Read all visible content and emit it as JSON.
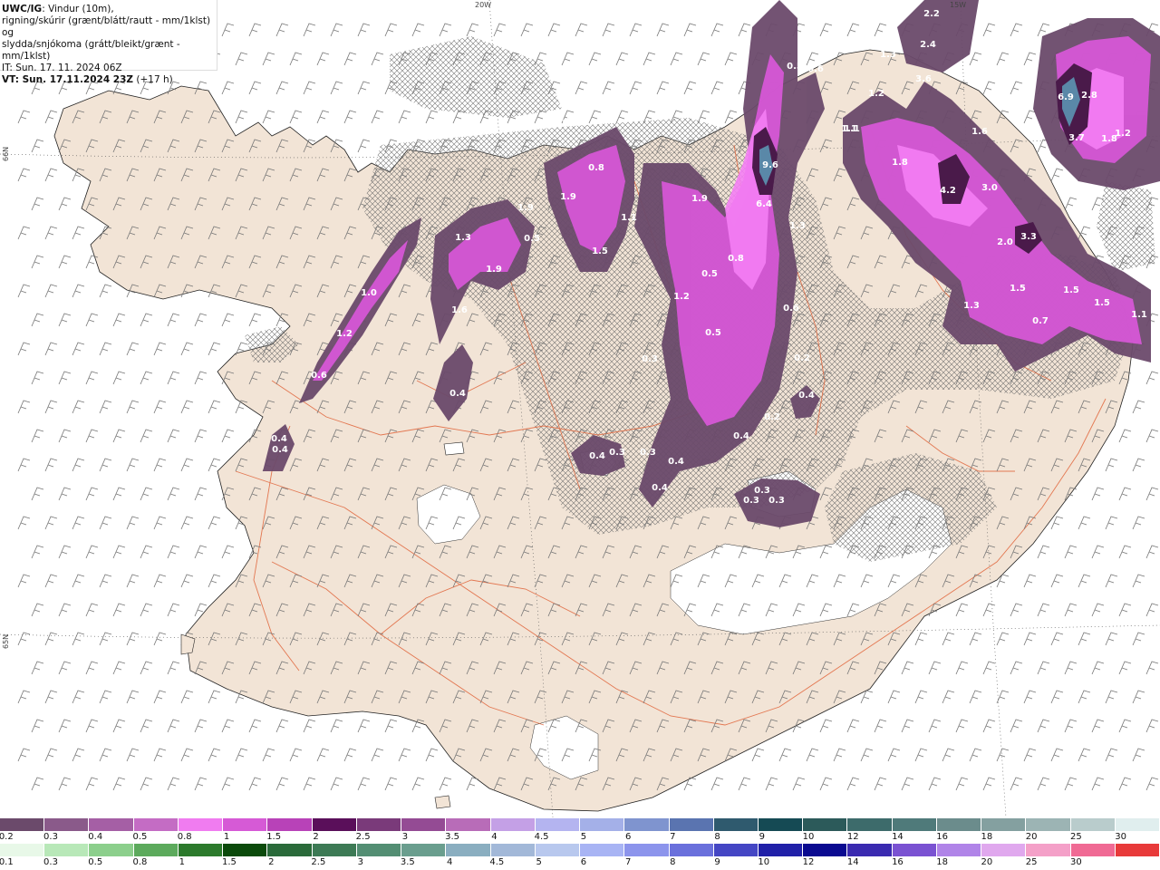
{
  "title": {
    "model": "UWC/IG",
    "line1": ": Vindur (10m),",
    "line2": "rigning/skúrir (grænt/blátt/rautt - mm/1klst) og",
    "line3": "slydda/snjókoma (grátt/bleikt/grænt - mm/1klst)",
    "init": "IT: Sun. 17. 11. 2024 06Z",
    "valid": "VT: Sun. 17.11.2024 23Z",
    "lead": "(+17 h)"
  },
  "graticule": {
    "meridians": [
      "20W",
      "15W"
    ],
    "parallels": [
      "66N",
      "65N"
    ]
  },
  "precip_labels": [
    {
      "v": "9.6"
    },
    {
      "v": "6.4"
    },
    {
      "v": "6.9"
    },
    {
      "v": "4.2"
    },
    {
      "v": "3.7"
    },
    {
      "v": "3.6"
    },
    {
      "v": "3.3"
    },
    {
      "v": "3.0"
    },
    {
      "v": "2.8"
    },
    {
      "v": "2.4"
    },
    {
      "v": "2.2"
    },
    {
      "v": "2.0"
    },
    {
      "v": "1.9"
    },
    {
      "v": "1.9"
    },
    {
      "v": "1.9"
    },
    {
      "v": "1.9"
    },
    {
      "v": "1.8"
    },
    {
      "v": "1.8"
    },
    {
      "v": "1.6"
    },
    {
      "v": "1.6"
    },
    {
      "v": "1.5"
    },
    {
      "v": "1.5"
    },
    {
      "v": "1.5"
    },
    {
      "v": "1.5"
    },
    {
      "v": "1.3"
    },
    {
      "v": "1.3"
    },
    {
      "v": "1.3"
    },
    {
      "v": "1.3"
    },
    {
      "v": "1.2"
    },
    {
      "v": "1.2"
    },
    {
      "v": "1.2"
    },
    {
      "v": "1.2"
    },
    {
      "v": "1.1"
    },
    {
      "v": "1.1"
    },
    {
      "v": "1.1"
    },
    {
      "v": "1.0"
    },
    {
      "v": "0.8"
    },
    {
      "v": "0.8"
    },
    {
      "v": "0.7"
    },
    {
      "v": "0.6"
    },
    {
      "v": "0.6"
    },
    {
      "v": "0.6"
    },
    {
      "v": "0.5"
    },
    {
      "v": "0.5"
    },
    {
      "v": "0.5"
    },
    {
      "v": "0.5"
    },
    {
      "v": "0.4"
    },
    {
      "v": "0.4"
    },
    {
      "v": "0.4"
    },
    {
      "v": "0.4"
    },
    {
      "v": "0.4"
    },
    {
      "v": "0.4"
    },
    {
      "v": "0.4"
    },
    {
      "v": "0.4"
    },
    {
      "v": "0.3"
    },
    {
      "v": "0.3"
    },
    {
      "v": "0.3"
    },
    {
      "v": "0.3"
    },
    {
      "v": "0.3"
    },
    {
      "v": "0.3"
    },
    {
      "v": "0.3"
    },
    {
      "v": "0.2"
    },
    {
      "v": "0.2"
    },
    {
      "v": "1.1"
    }
  ],
  "legend": {
    "snow": {
      "labels": [
        "0.2",
        "0.3",
        "0.4",
        "0.5",
        "0.8",
        "1",
        "1.5",
        "2",
        "2.5",
        "3",
        "3.5",
        "4",
        "4.5",
        "5",
        "6",
        "7",
        "8",
        "9",
        "10",
        "12",
        "14",
        "16",
        "18",
        "20",
        "25",
        "30"
      ],
      "colors": [
        "#6b4a6b",
        "#8a5a8a",
        "#a55fa5",
        "#c46cc4",
        "#f07cf0",
        "#d65ad6",
        "#b842b8",
        "#5a0f5a",
        "#7a3a7a",
        "#944b94",
        "#b86cb8",
        "#c4a0e6",
        "#b4b4f0",
        "#a4b0e8",
        "#7f94cf",
        "#5a74b0",
        "#2f5a6e",
        "#154a54",
        "#2c5a5a",
        "#3d6b6b",
        "#4f7a7a",
        "#6b8c8c",
        "#84a0a0",
        "#9cb4b4",
        "#b9cccc",
        "#e0eeee"
      ]
    },
    "rain": {
      "labels": [
        "0.1",
        "0.3",
        "0.5",
        "0.8",
        "1",
        "1.5",
        "2",
        "2.5",
        "3",
        "3.5",
        "4",
        "4.5",
        "5",
        "6",
        "7",
        "8",
        "9",
        "10",
        "12",
        "14",
        "16",
        "18",
        "20",
        "25",
        "30"
      ],
      "colors": [
        "#e8f8e8",
        "#b8e8b8",
        "#8ccf8c",
        "#5caa5c",
        "#2c7a2c",
        "#0b4a0b",
        "#2a6a3a",
        "#3d7a55",
        "#538e73",
        "#6a9e8e",
        "#8aaec0",
        "#a2b8d8",
        "#b8c8ee",
        "#a8b4f4",
        "#8c94ec",
        "#6a70dc",
        "#4446c4",
        "#2020a8",
        "#0a0a90",
        "#3a2ab0",
        "#7a52d2",
        "#b084e8",
        "#e0a8ee",
        "#f4a0c8",
        "#f06a94",
        "#e83a3a"
      ]
    }
  }
}
